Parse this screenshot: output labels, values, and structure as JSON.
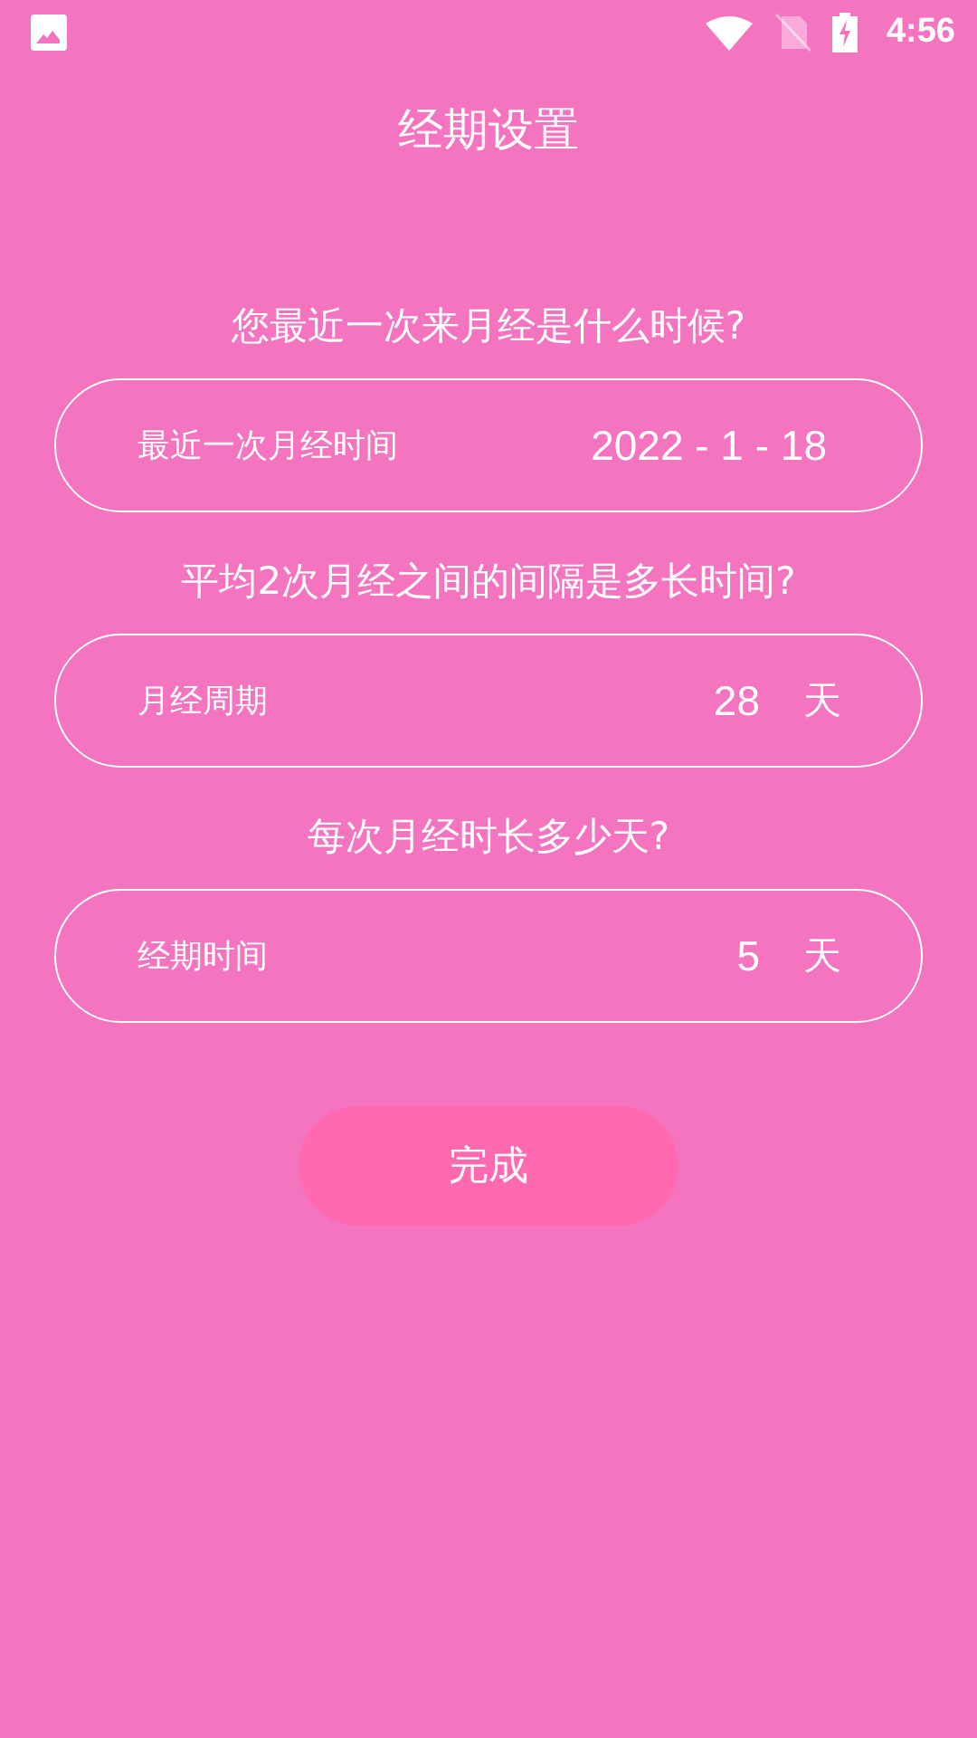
{
  "status_bar": {
    "time": "4:56"
  },
  "title": "经期设置",
  "sections": [
    {
      "question": "您最近一次来月经是什么时候?",
      "label": "最近一次月经时间",
      "value": "2022 - 1 - 18"
    },
    {
      "question": "平均2次月经之间的间隔是多长时间?",
      "label": "月经周期",
      "value": "28",
      "unit": "天"
    },
    {
      "question": "每次月经时长多少天?",
      "label": "经期时间",
      "value": "5",
      "unit": "天"
    }
  ],
  "button": "完成"
}
